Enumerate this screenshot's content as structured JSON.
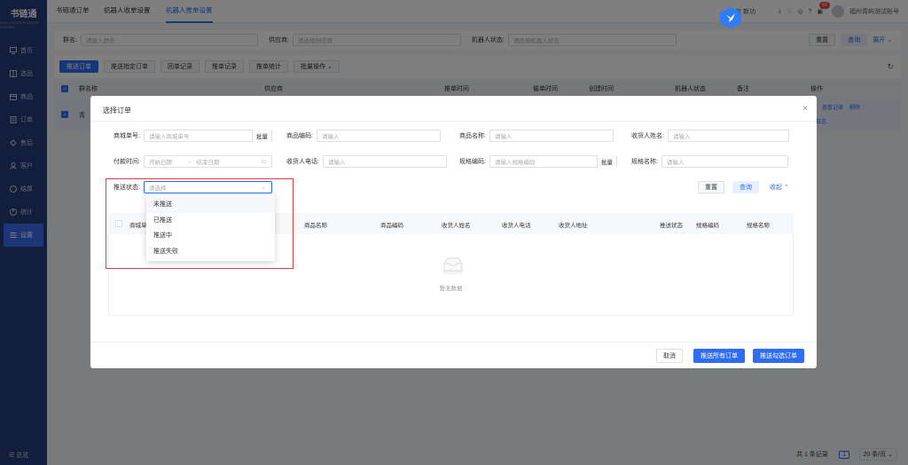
{
  "app": {
    "logo_title": "书链通",
    "logo_sub": "SHULIANTONG ORDER SYSTEM"
  },
  "sidebar": {
    "items": [
      {
        "label": "首页",
        "icon": "monitor-icon"
      },
      {
        "label": "选品",
        "icon": "grid-icon"
      },
      {
        "label": "商品",
        "icon": "box-icon"
      },
      {
        "label": "订单",
        "icon": "order-icon"
      },
      {
        "label": "售后",
        "icon": "service-icon"
      },
      {
        "label": "客户",
        "icon": "user-icon"
      },
      {
        "label": "结算",
        "icon": "settle-icon"
      },
      {
        "label": "统计",
        "icon": "chart-icon"
      },
      {
        "label": "设置",
        "icon": "settings-icon"
      }
    ],
    "collapse_label": "总览"
  },
  "topbar": {
    "tabs": [
      "书链通订单",
      "机器人收单设置",
      "机器人推单设置"
    ],
    "active_tab": "机器人推单设置",
    "new_label": "新功",
    "notification_count": "61",
    "account_name": "福州青屿测试账号"
  },
  "filters": {
    "group_label": "群名:",
    "group_placeholder": "请输入群名",
    "supplier_label": "供应商:",
    "supplier_placeholder": "请选择供应商",
    "robot_label": "机器人状态:",
    "robot_placeholder": "请选择机器人状态",
    "reset": "重置",
    "query": "查询",
    "expand": "展开"
  },
  "toolbar": {
    "buttons": [
      "推送订单",
      "推送指定订单",
      "回单记录",
      "推单记录",
      "推单统计",
      "批量操作"
    ]
  },
  "table": {
    "headers": [
      "群名称",
      "供应商",
      "推单时间",
      "催单时间",
      "创建时间",
      "机器人状态",
      "备注",
      "操作"
    ],
    "row_group_name": "青",
    "row_actions": [
      "编",
      "查看记录",
      "删除",
      "作日志"
    ]
  },
  "pagination": {
    "total": "共 1 条记录",
    "page": "1",
    "page_size": "20 条/页"
  },
  "modal": {
    "title": "选择订单",
    "fields": {
      "mall_order_label": "商城单号:",
      "mall_order_placeholder": "请输入商城单号",
      "batch": "批量",
      "product_code_label": "商品编码:",
      "product_code_placeholder": "请输入",
      "product_name_label": "商品名称:",
      "product_name_placeholder": "请输入",
      "receiver_name_label": "收货人姓名:",
      "receiver_name_placeholder": "请输入",
      "pay_time_label": "付款时间:",
      "start_date": "开始日期",
      "end_date": "结束日期",
      "receiver_phone_label": "收货人电话:",
      "receiver_phone_placeholder": "请输入",
      "spec_code_label": "规格编码:",
      "spec_code_placeholder": "请输入规格编码",
      "spec_name_label": "规格名称:",
      "spec_name_placeholder": "请输入",
      "push_status_label": "推送状态:",
      "push_status_placeholder": "请选择"
    },
    "reset": "重置",
    "query": "查询",
    "collapse": "收起",
    "columns": [
      "商城单",
      "商品名称",
      "商品编码",
      "收货人姓名",
      "收货人电话",
      "收货人地址",
      "推送状态",
      "规格编码",
      "规格名称"
    ],
    "empty_text": "暂无数据",
    "cancel": "取消",
    "push_all": "推送所有订单",
    "push_selected": "推送勾选订单"
  },
  "dropdown": {
    "options": [
      "未推送",
      "已推送",
      "推送中",
      "推送失败"
    ]
  },
  "colors": {
    "primary": "#2f6cf0",
    "sidebar": "#253c77",
    "highlight": "#e23c3c"
  }
}
